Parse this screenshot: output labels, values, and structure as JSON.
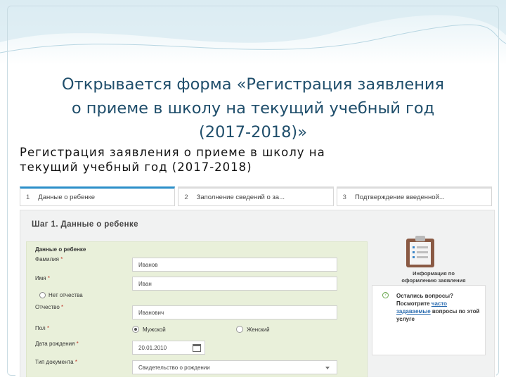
{
  "slide": {
    "title_line1": "Открывается форма «Регистрация заявления",
    "title_line2": "о приеме в школу на текущий учебный год",
    "title_line3": "(2017-2018)»"
  },
  "form": {
    "heading_line1": "Регистрация заявления о приеме в школу на",
    "heading_line2": "текущий учебный год (2017-2018)",
    "steps": [
      {
        "num": "1",
        "label": "Данные о ребенке"
      },
      {
        "num": "2",
        "label": "Заполнение сведений о за..."
      },
      {
        "num": "3",
        "label": "Подтверждение введенной..."
      }
    ],
    "step_title": "Шаг 1. Данные о ребенке",
    "section_label": "Данные о ребенке",
    "fields": {
      "surname": {
        "label": "Фамилия",
        "value": "Иванов"
      },
      "name": {
        "label": "Имя",
        "value": "Иван"
      },
      "no_patronymic": {
        "label": "Нет отчества"
      },
      "patronymic": {
        "label": "Отчество",
        "value": "Иванович"
      },
      "gender": {
        "label": "Пол",
        "option_male": "Мужской",
        "option_female": "Женский"
      },
      "birthdate": {
        "label": "Дата рождения",
        "value": "20.01.2010"
      },
      "doc_type": {
        "label": "Тип документа",
        "value": "Свидетельство о рождении"
      }
    },
    "required_mark": "*"
  },
  "sidebar": {
    "info_caption_line1": "Информация по",
    "info_caption_line2": "оформлению заявления",
    "help_pre": "Остались вопросы? Посмотрите",
    "help_link": "часто задаваемые",
    "help_post": "вопросы по этой услуге"
  },
  "colors": {
    "title": "#1f4e6b",
    "active_step": "#2b8fc9",
    "form_bg": "#e9f0da",
    "link": "#2b6cb0"
  }
}
